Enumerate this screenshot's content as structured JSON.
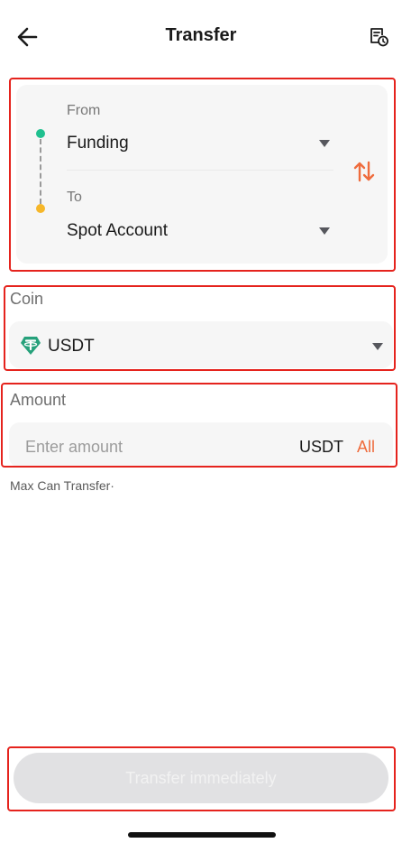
{
  "header": {
    "title": "Transfer",
    "back_icon": "arrow-left-icon",
    "history_icon": "records-history-icon"
  },
  "transfer": {
    "from_label": "From",
    "from_value": "Funding",
    "to_label": "To",
    "to_value": "Spot Account",
    "swap_icon": "swap-arrows-icon"
  },
  "coin": {
    "label": "Coin",
    "value": "USDT",
    "icon": "tether-icon"
  },
  "amount": {
    "label": "Amount",
    "placeholder": "Enter amount",
    "unit": "USDT",
    "all_label": "All"
  },
  "max_transfer_text": "Max Can Transfer·",
  "submit_label": "Transfer immediately",
  "colors": {
    "accent": "#ef6c3d",
    "highlight_border": "#e5231d",
    "from_dot": "#1fc08f",
    "to_dot": "#f6b72a",
    "tether": "#26a17b",
    "button_disabled": "#e1e1e3"
  }
}
